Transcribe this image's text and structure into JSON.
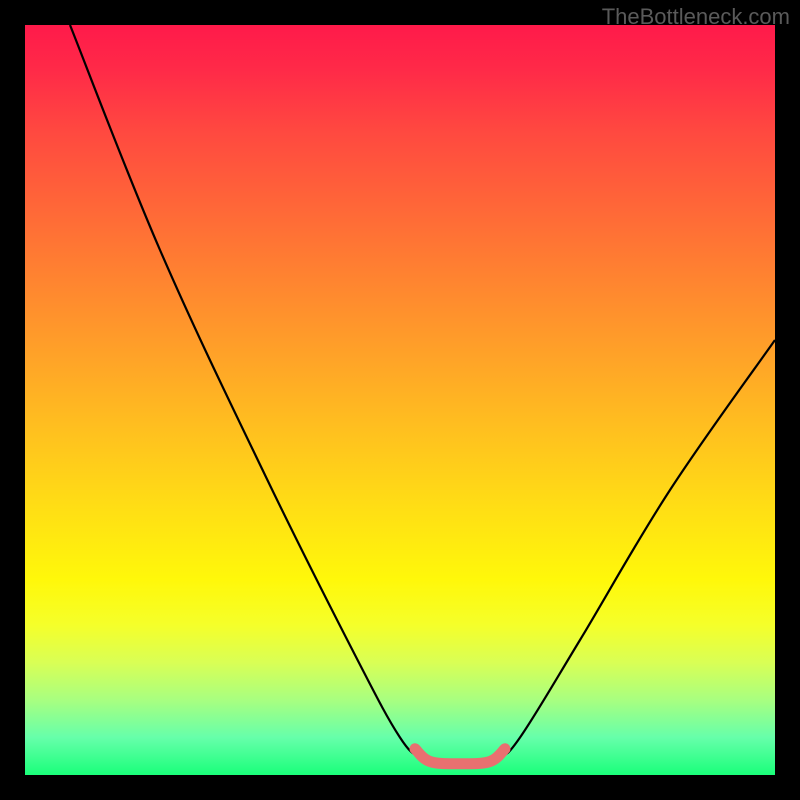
{
  "watermark": "TheBottleneck.com",
  "chart_data": {
    "type": "line",
    "title": "",
    "xlabel": "",
    "ylabel": "",
    "xlim": [
      0,
      100
    ],
    "ylim": [
      0,
      100
    ],
    "series": [
      {
        "name": "bottleneck-curve",
        "points": [
          {
            "x": 6,
            "y": 100
          },
          {
            "x": 18,
            "y": 70
          },
          {
            "x": 32,
            "y": 40
          },
          {
            "x": 44,
            "y": 16
          },
          {
            "x": 50,
            "y": 5
          },
          {
            "x": 53,
            "y": 2.2
          },
          {
            "x": 56,
            "y": 1.4
          },
          {
            "x": 60,
            "y": 1.4
          },
          {
            "x": 63,
            "y": 2.2
          },
          {
            "x": 66,
            "y": 5
          },
          {
            "x": 74,
            "y": 18
          },
          {
            "x": 86,
            "y": 38
          },
          {
            "x": 100,
            "y": 58
          }
        ]
      },
      {
        "name": "optimal-zone-marker",
        "points": [
          {
            "x": 52,
            "y": 3.5
          },
          {
            "x": 54,
            "y": 1.8
          },
          {
            "x": 58,
            "y": 1.5
          },
          {
            "x": 62,
            "y": 1.8
          },
          {
            "x": 64,
            "y": 3.5
          }
        ]
      }
    ],
    "gradient_stops": [
      {
        "pos": 0,
        "color": "#ff1a4a"
      },
      {
        "pos": 50,
        "color": "#ffc01f"
      },
      {
        "pos": 80,
        "color": "#fff80a"
      },
      {
        "pos": 100,
        "color": "#1aff7a"
      }
    ]
  }
}
